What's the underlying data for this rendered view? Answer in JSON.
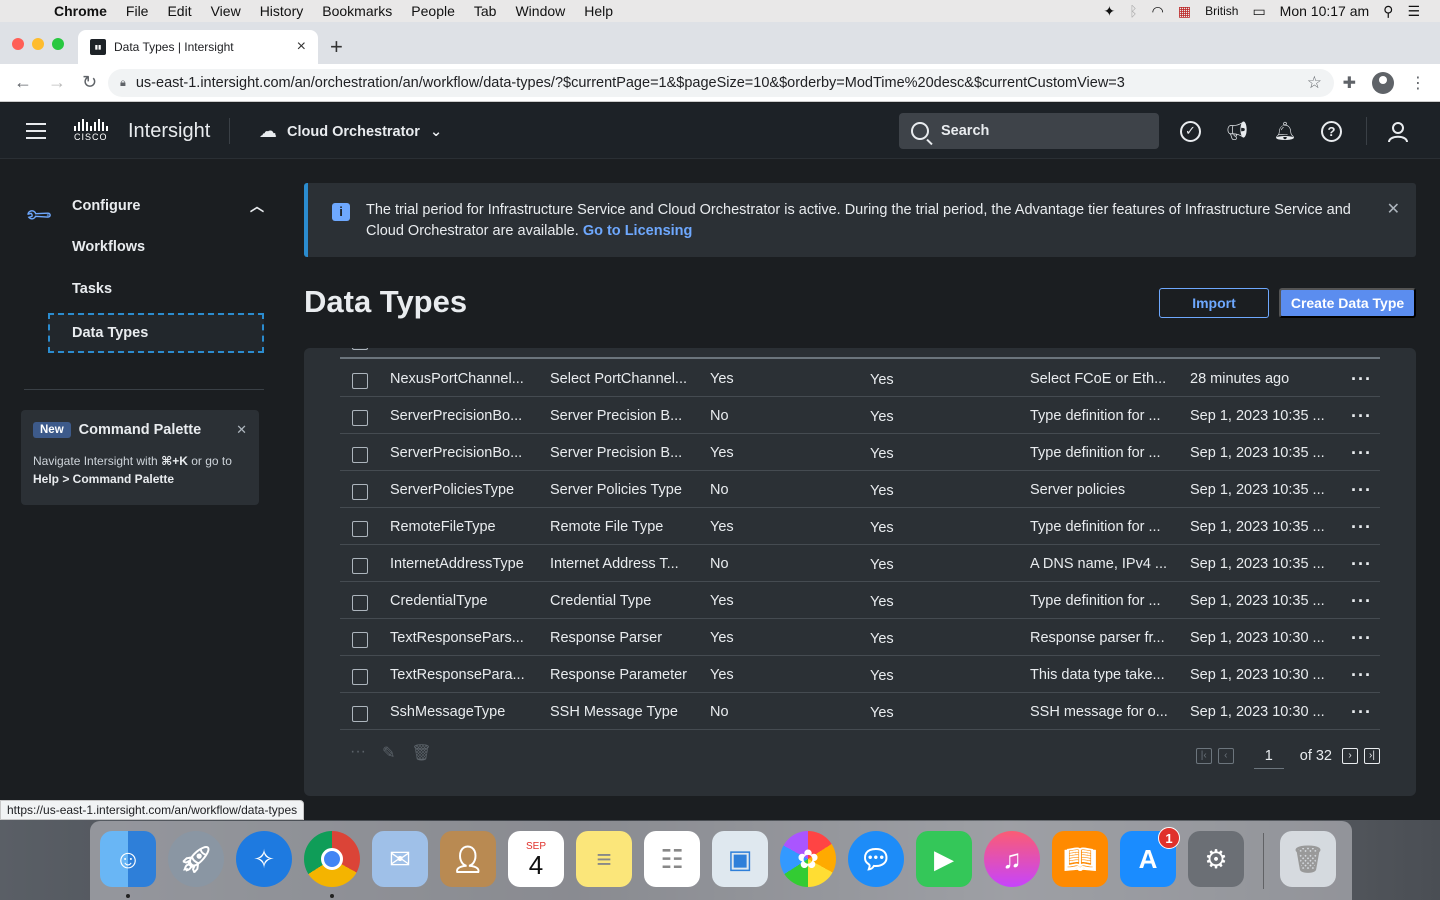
{
  "mac_menubar": {
    "app": "Chrome",
    "items": [
      "File",
      "Edit",
      "View",
      "History",
      "Bookmarks",
      "People",
      "Tab",
      "Window",
      "Help"
    ],
    "input_source": "British",
    "clock": "Mon 10:17 am"
  },
  "browser": {
    "tab_title": "Data Types | Intersight",
    "url": "us-east-1.intersight.com/an/orchestration/an/workflow/data-types/?$currentPage=1&$pageSize=10&$orderby=ModTime%20desc&$currentCustomView=3",
    "status_url": "https://us-east-1.intersight.com/an/workflow/data-types"
  },
  "header": {
    "logo_word": "CISCO",
    "app_name": "Intersight",
    "service": "Cloud Orchestrator",
    "search_placeholder": "Search"
  },
  "sidebar": {
    "group_label": "Configure",
    "items": [
      {
        "label": "Workflows",
        "active": false
      },
      {
        "label": "Tasks",
        "active": false
      },
      {
        "label": "Data Types",
        "active": true
      }
    ],
    "command_card": {
      "badge": "New",
      "title": "Command Palette",
      "desc_prefix": "Navigate Intersight with ",
      "shortcut": "⌘+K",
      "desc_mid": " or go to ",
      "desc_link": "Help > Command Palette"
    }
  },
  "banner": {
    "text": "The trial period for Infrastructure Service and Cloud Orchestrator is active. During the trial period, the Advantage tier features of Infrastructure Service and Cloud Orchestrator are available. ",
    "link": "Go to Licensing"
  },
  "page": {
    "title": "Data Types",
    "import_label": "Import",
    "create_label": "Create Data Type"
  },
  "table": {
    "rows": [
      {
        "name": "NexusPortChannel...",
        "display": "Select PortChannel...",
        "col3": "Yes",
        "col4": "Yes",
        "desc": "Select FCoE or Eth...",
        "modified": "28 minutes ago"
      },
      {
        "name": "ServerPrecisionBo...",
        "display": "Server Precision B...",
        "col3": "No",
        "col4": "Yes",
        "desc": "Type definition for ...",
        "modified": "Sep 1, 2023 10:35 ..."
      },
      {
        "name": "ServerPrecisionBo...",
        "display": "Server Precision B...",
        "col3": "Yes",
        "col4": "Yes",
        "desc": "Type definition for ...",
        "modified": "Sep 1, 2023 10:35 ..."
      },
      {
        "name": "ServerPoliciesType",
        "display": "Server Policies Type",
        "col3": "No",
        "col4": "Yes",
        "desc": "Server policies",
        "modified": "Sep 1, 2023 10:35 ..."
      },
      {
        "name": "RemoteFileType",
        "display": "Remote File Type",
        "col3": "Yes",
        "col4": "Yes",
        "desc": "Type definition for ...",
        "modified": "Sep 1, 2023 10:35 ..."
      },
      {
        "name": "InternetAddressType",
        "display": "Internet Address T...",
        "col3": "No",
        "col4": "Yes",
        "desc": "A DNS name, IPv4 ...",
        "modified": "Sep 1, 2023 10:35 ..."
      },
      {
        "name": "CredentialType",
        "display": "Credential Type",
        "col3": "Yes",
        "col4": "Yes",
        "desc": "Type definition for ...",
        "modified": "Sep 1, 2023 10:35 ..."
      },
      {
        "name": "TextResponsePars...",
        "display": "Response Parser",
        "col3": "Yes",
        "col4": "Yes",
        "desc": "Response parser fr...",
        "modified": "Sep 1, 2023 10:30 ..."
      },
      {
        "name": "TextResponsePara...",
        "display": "Response Parameter",
        "col3": "Yes",
        "col4": "Yes",
        "desc": "This data type take...",
        "modified": "Sep 1, 2023 10:30 ..."
      },
      {
        "name": "SshMessageType",
        "display": "SSH Message Type",
        "col3": "No",
        "col4": "Yes",
        "desc": "SSH message for o...",
        "modified": "Sep 1, 2023 10:30 ..."
      }
    ],
    "pagination": {
      "current": "1",
      "total_label": "of 32"
    }
  },
  "dock": {
    "calendar_month": "SEP",
    "calendar_day": "4",
    "appstore_badge": "1"
  }
}
